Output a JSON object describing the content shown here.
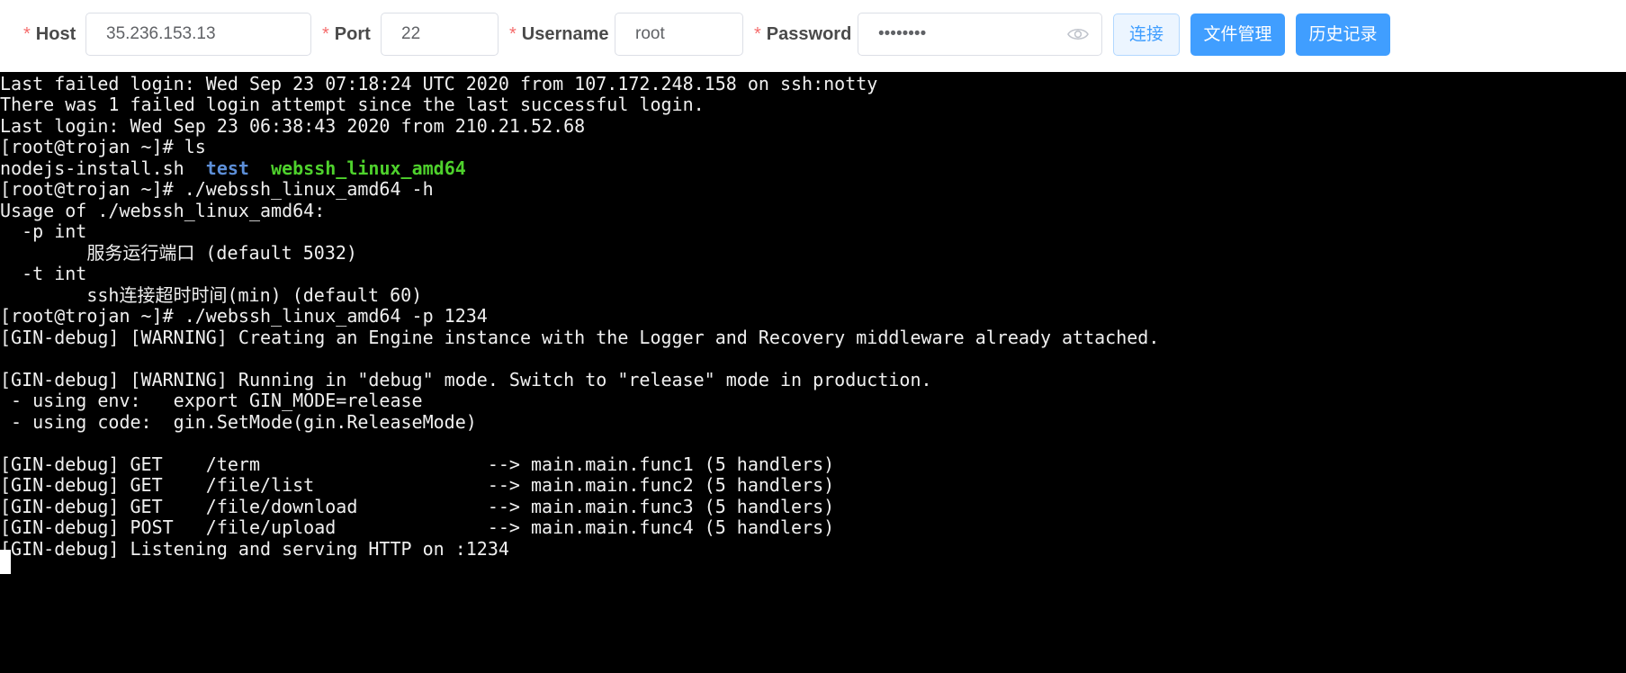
{
  "toolbar": {
    "host": {
      "required_mark": "*",
      "label": "Host",
      "value": "35.236.153.13"
    },
    "port": {
      "required_mark": "*",
      "label": "Port",
      "value": "22"
    },
    "username": {
      "required_mark": "*",
      "label": "Username",
      "value": "root"
    },
    "password": {
      "required_mark": "*",
      "label": "Password",
      "value": "••••••••",
      "toggle_icon": "eye-icon"
    },
    "connect_label": "连接",
    "files_label": "文件管理",
    "history_label": "历史记录"
  },
  "terminal": {
    "lines": [
      "Last failed login: Wed Sep 23 07:18:24 UTC 2020 from 107.172.248.158 on ssh:notty",
      "There was 1 failed login attempt since the last successful login.",
      "Last login: Wed Sep 23 06:38:43 2020 from 210.21.52.68",
      "[root@trojan ~]# ls",
      "",
      "[root@trojan ~]# ./webssh_linux_amd64 -h",
      "Usage of ./webssh_linux_amd64:",
      "  -p int",
      "        服务运行端口 (default 5032)",
      "  -t int",
      "        ssh连接超时时间(min) (default 60)",
      "[root@trojan ~]# ./webssh_linux_amd64 -p 1234",
      "[GIN-debug] [WARNING] Creating an Engine instance with the Logger and Recovery middleware already attached.",
      "",
      "[GIN-debug] [WARNING] Running in \"debug\" mode. Switch to \"release\" mode in production.",
      " - using env:   export GIN_MODE=release",
      " - using code:  gin.SetMode(gin.ReleaseMode)",
      "",
      "[GIN-debug] GET    /term                     --> main.main.func1 (5 handlers)",
      "[GIN-debug] GET    /file/list                --> main.main.func2 (5 handlers)",
      "[GIN-debug] GET    /file/download            --> main.main.func3 (5 handlers)",
      "[GIN-debug] POST   /file/upload              --> main.main.func4 (5 handlers)",
      "[GIN-debug] Listening and serving HTTP on :1234"
    ],
    "ls_output": {
      "file": "nodejs-install.sh",
      "dir": "test",
      "exe": "webssh_linux_amd64"
    }
  },
  "colors": {
    "required": "#f56c6c",
    "primary": "#409eff",
    "plain_bg": "#ecf5ff",
    "dir": "#5d8fd8",
    "exe": "#4ed12c"
  }
}
